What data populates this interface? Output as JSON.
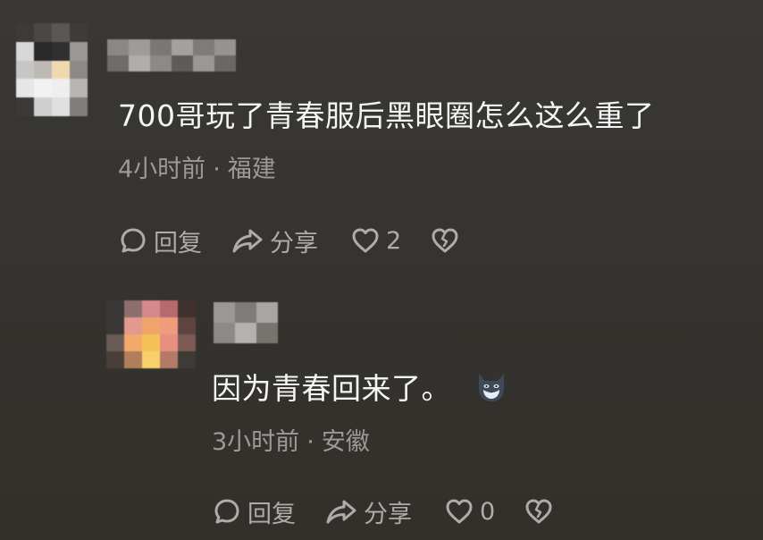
{
  "comments": [
    {
      "text": "700哥玩了青春服后黑眼圈怎么这么重了",
      "time": "4小时前",
      "location": "福建",
      "reply_label": "回复",
      "share_label": "分享",
      "like_count": "2"
    },
    {
      "text": "因为青春回来了。",
      "time": "3小时前",
      "location": "安徽",
      "reply_label": "回复",
      "share_label": "分享",
      "like_count": "0",
      "emoji_icon": "cat-face-emoji"
    }
  ],
  "separator": "·",
  "colors": {
    "background": "#383633",
    "text_primary": "#f5f5f5",
    "text_secondary": "#9c9a97",
    "icon": "#aeaca9"
  }
}
